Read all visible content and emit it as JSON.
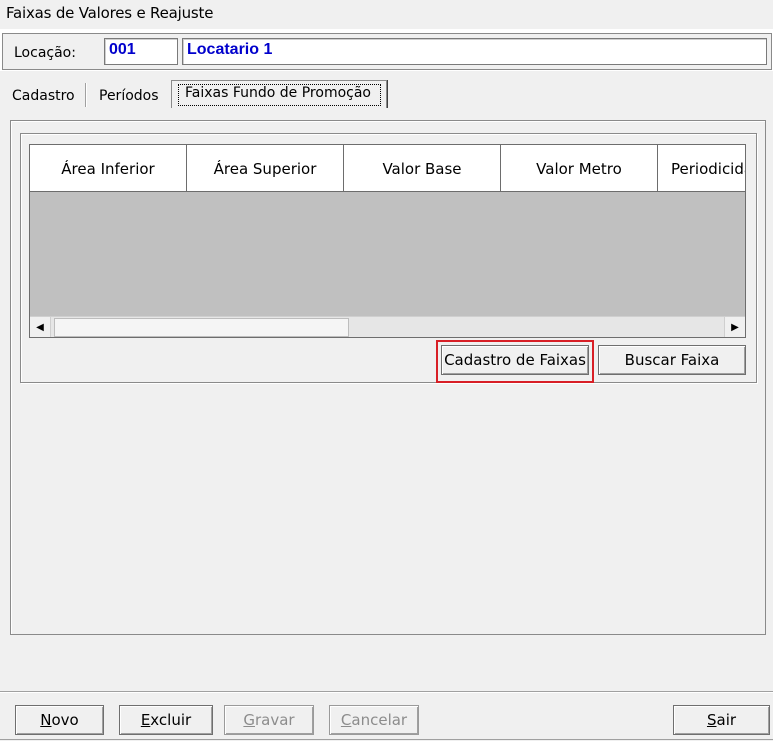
{
  "window": {
    "title": "Faixas de Valores e Reajuste"
  },
  "location": {
    "label": "Locação:",
    "code": "001",
    "name": "Locatario 1"
  },
  "tabs": [
    {
      "label": "Cadastro",
      "active": false
    },
    {
      "label": "Períodos",
      "active": false
    },
    {
      "label": "Faixas Fundo de Promoção",
      "active": true
    }
  ],
  "grid": {
    "columns": [
      "Área Inferior",
      "Área Superior",
      "Valor Base",
      "Valor Metro",
      "Periodicida"
    ],
    "rows": []
  },
  "group_buttons": {
    "cadastro_faixas": "Cadastro de Faixas",
    "buscar_faixa": "Buscar Faixa"
  },
  "footer": {
    "novo": "Novo",
    "excluir": "Excluir",
    "gravar": "Gravar",
    "cancelar": "Cancelar",
    "sair": "Sair"
  },
  "colors": {
    "highlight": "#d81f26",
    "field_text": "#0000cc",
    "grid_background": "#c0c0c0"
  }
}
